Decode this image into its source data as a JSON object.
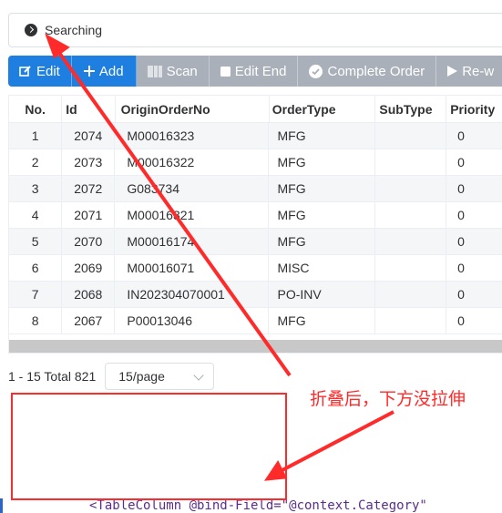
{
  "search": {
    "label": "Searching"
  },
  "toolbar": {
    "edit": "Edit",
    "add": "Add",
    "scan": "Scan",
    "edit_end": "Edit End",
    "complete_order": "Complete Order",
    "rework": "Re-w"
  },
  "table": {
    "headers": [
      "No.",
      "Id",
      "OriginOrderNo",
      "OrderType",
      "SubType",
      "Priority"
    ],
    "rows": [
      [
        "1",
        "2074",
        "M00016323",
        "MFG",
        "",
        "0"
      ],
      [
        "2",
        "2073",
        "M00016322",
        "MFG",
        "",
        "0"
      ],
      [
        "3",
        "2072",
        "G083734",
        "MFG",
        "",
        "0"
      ],
      [
        "4",
        "2071",
        "M00016321",
        "MFG",
        "",
        "0"
      ],
      [
        "5",
        "2070",
        "M00016174",
        "MFG",
        "",
        "0"
      ],
      [
        "6",
        "2069",
        "M00016071",
        "MISC",
        "",
        "0"
      ],
      [
        "7",
        "2068",
        "IN202304070001",
        "PO-INV",
        "",
        "0"
      ],
      [
        "8",
        "2067",
        "P00013046",
        "MFG",
        "",
        "0"
      ]
    ]
  },
  "pager": {
    "total": "1 - 15 Total 821",
    "page_size": "15/page"
  },
  "annotation": {
    "note": "折叠后，下方没拉伸"
  },
  "code": {
    "line": "<TableColumn @bind-Field=\"@context.Category\""
  },
  "colors": {
    "primary": "#1e7fe0",
    "disabled": "#a9b0b9",
    "annotation": "#ff2a2a"
  },
  "icons": [
    "chevron-right-circle-icon",
    "edit-icon",
    "plus-icon",
    "barcode-icon",
    "stop-icon",
    "check-circle-icon",
    "play-icon"
  ]
}
